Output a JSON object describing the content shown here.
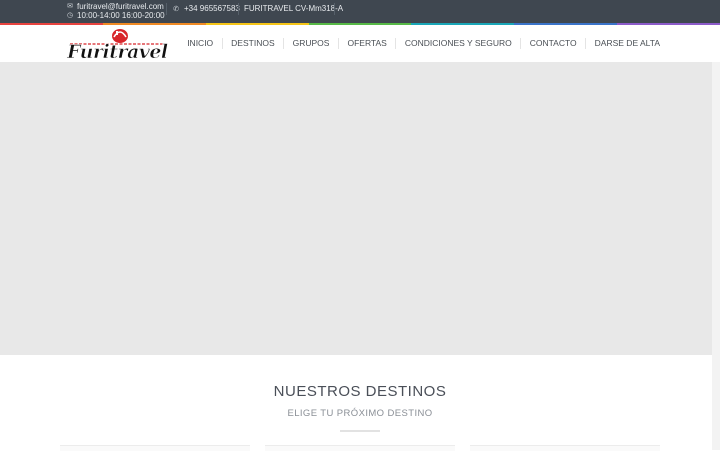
{
  "topbar": {
    "email": "furitravel@furitravel.com",
    "hours": "10:00-14:00 16:00-20:00",
    "phone": "+34 965567583",
    "license": "FURITRAVEL CV-Mm318-A",
    "icons": {
      "email": "envelope-icon",
      "hours": "clock-icon",
      "phone": "phone-icon"
    }
  },
  "colorbar": [
    "#e8433f",
    "#f08a24",
    "#f5c518",
    "#57b947",
    "#1aa6b7",
    "#3b74c9",
    "#8c5bc9"
  ],
  "logo": {
    "text": "Furitravel",
    "alt": "Furitravel"
  },
  "nav": {
    "items": [
      "INICIO",
      "DESTINOS",
      "GRUPOS",
      "OFERTAS",
      "CONDICIONES Y SEGURO",
      "CONTACTO",
      "DARSE DE ALTA"
    ]
  },
  "section": {
    "title": "NUESTROS DESTINOS",
    "subtitle": "ELIGE TU PRÓXIMO DESTINO"
  }
}
